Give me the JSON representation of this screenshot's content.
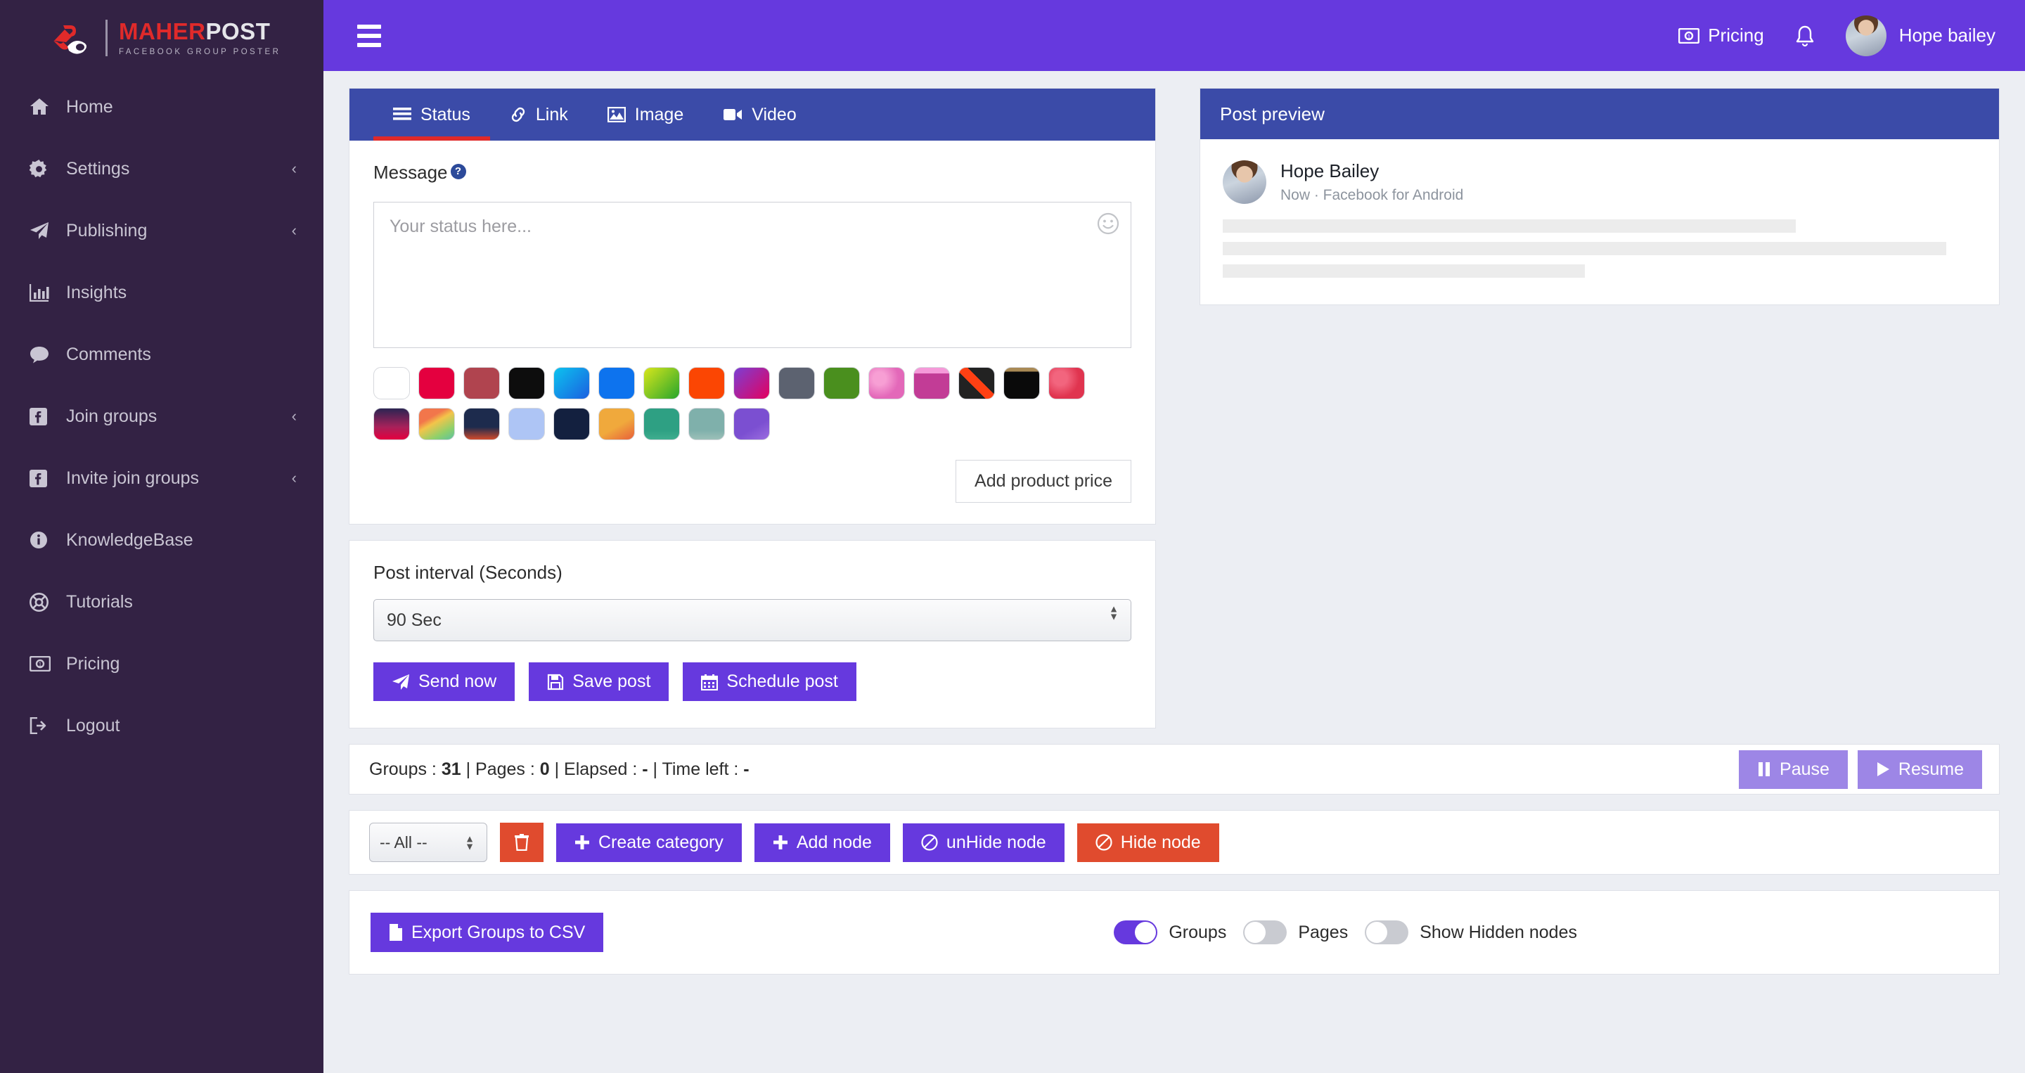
{
  "brand": {
    "name_primary": "MAHER",
    "name_secondary": "POST",
    "tagline": "FACEBOOK GROUP POSTER",
    "primary_color": "#e02a2a",
    "sidebar_color": "#332244"
  },
  "sidebar": {
    "items": [
      {
        "label": "Home",
        "icon": "home-icon",
        "caret": ""
      },
      {
        "label": "Settings",
        "icon": "gear-icon",
        "caret": "‹"
      },
      {
        "label": "Publishing",
        "icon": "paper-plane-icon",
        "caret": "‹"
      },
      {
        "label": "Insights",
        "icon": "bar-chart-icon",
        "caret": ""
      },
      {
        "label": "Comments",
        "icon": "comment-icon",
        "caret": ""
      },
      {
        "label": "Join groups",
        "icon": "facebook-icon",
        "caret": "‹"
      },
      {
        "label": "Invite join groups",
        "icon": "facebook-icon",
        "caret": "‹"
      },
      {
        "label": "KnowledgeBase",
        "icon": "info-circle-icon",
        "caret": ""
      },
      {
        "label": "Tutorials",
        "icon": "lifebuoy-icon",
        "caret": ""
      },
      {
        "label": "Pricing",
        "icon": "money-bill-icon",
        "caret": ""
      },
      {
        "label": "Logout",
        "icon": "sign-out-icon",
        "caret": ""
      }
    ]
  },
  "header": {
    "menu_icon": "hamburger-icon",
    "pricing_label": "Pricing",
    "pricing_icon": "money-bill-icon",
    "notification_icon": "bell-icon",
    "user_name": "Hope bailey",
    "accent_color": "#6639de"
  },
  "composer": {
    "tabs": [
      {
        "label": "Status",
        "icon": "list-icon",
        "active": true
      },
      {
        "label": "Link",
        "icon": "link-icon",
        "active": false
      },
      {
        "label": "Image",
        "icon": "image-icon",
        "active": false
      },
      {
        "label": "Video",
        "icon": "video-icon",
        "active": false
      }
    ],
    "tab_bar_color": "#3b4ba8",
    "active_indicator_color": "#e02a2a",
    "message_label": "Message",
    "message_help_icon": "question-circle-icon",
    "message_value": "",
    "message_placeholder": "Your status here...",
    "emoji_icon": "smiley-icon",
    "add_price_label": "Add product price",
    "swatches_row1": [
      "#ffffff",
      "#e4003f",
      "#b0444f",
      "#0d0d0d",
      "#0fa9dd",
      "#0d73ee",
      "#6cc62a",
      "#fb4603",
      "#a5259f",
      "#5c6270",
      "#4a8f1e",
      "#ef6fc0",
      "#bb3f96",
      "#3b2a2a",
      "#0b0b0b",
      "#e8405c",
      "#39214f"
    ],
    "swatches_row2": [
      "#f2a04b",
      "#243357",
      "#aec5f5",
      "#0f1b38",
      "#ef9b3c",
      "#2ea083",
      "#7aa9a3",
      "#7b4fd1"
    ]
  },
  "interval": {
    "label": "Post interval (Seconds)",
    "value": "90 Sec",
    "options": [
      "90 Sec"
    ]
  },
  "actions": {
    "send_now": {
      "label": "Send now",
      "icon": "paper-plane-icon"
    },
    "save_post": {
      "label": "Save post",
      "icon": "floppy-disk-icon"
    },
    "schedule_post": {
      "label": "Schedule post",
      "icon": "calendar-icon"
    }
  },
  "preview": {
    "title": "Post preview",
    "user_name": "Hope Bailey",
    "meta": "Now · Facebook for Android",
    "skeleton_widths": [
      "76%",
      "96%",
      "48%"
    ]
  },
  "status_bar": {
    "groups_label": "Groups : ",
    "groups_value": "31",
    "pages_label": " | Pages : ",
    "pages_value": "0",
    "elapsed_label": " | Elapsed : ",
    "elapsed_value": "-",
    "time_left_label": " | Time left : ",
    "time_left_value": "-",
    "pause": {
      "label": "Pause",
      "icon": "pause-icon"
    },
    "resume": {
      "label": "Resume",
      "icon": "play-icon"
    }
  },
  "toolbar": {
    "category_value": "-- All --",
    "category_options": [
      "-- All --"
    ],
    "delete_icon": "trash-icon",
    "create_category": {
      "label": "Create category",
      "icon": "plus-icon"
    },
    "add_node": {
      "label": "Add node",
      "icon": "plus-icon"
    },
    "unhide_node": {
      "label": "unHide node",
      "icon": "ban-icon"
    },
    "hide_node": {
      "label": "Hide node",
      "icon": "ban-icon"
    }
  },
  "bottom": {
    "export_csv": {
      "label": "Export Groups to CSV",
      "icon": "file-icon"
    },
    "toggles": [
      {
        "label": "Groups",
        "on": true
      },
      {
        "label": "Pages",
        "on": false
      },
      {
        "label": "Show Hidden nodes",
        "on": false
      }
    ]
  }
}
